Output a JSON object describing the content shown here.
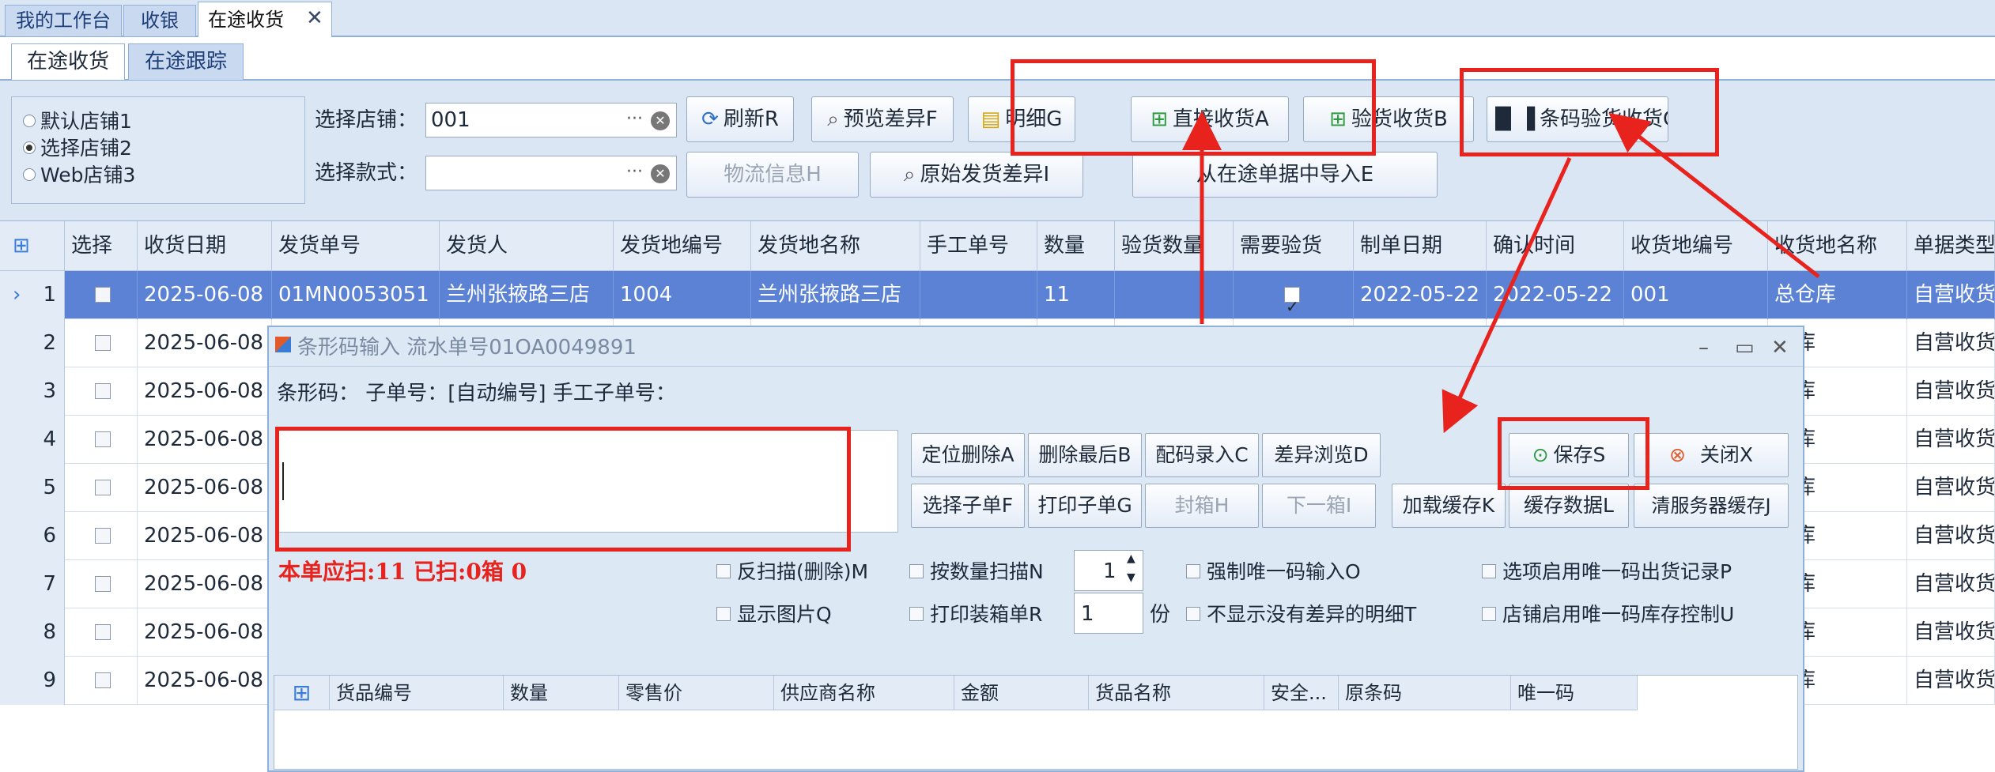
{
  "top_tabs": [
    {
      "label": "我的工作台"
    },
    {
      "label": "收银"
    },
    {
      "label": "在途收货",
      "active": true
    }
  ],
  "sub_tabs": [
    {
      "label": "在途收货",
      "active": true
    },
    {
      "label": "在途跟踪"
    }
  ],
  "filter": {
    "radios": [
      {
        "label": "默认店铺1",
        "selected": false
      },
      {
        "label": "选择店铺2",
        "selected": true
      },
      {
        "label": "Web店铺3",
        "selected": false
      }
    ],
    "store_label": "选择店铺：",
    "store_value": "001",
    "style_label": "选择款式：",
    "style_value": "",
    "buttons": {
      "refresh": "刷新R",
      "preview_diff": "预览差异F",
      "detail": "明细G",
      "direct_receive": "直接收货A",
      "inspect_receive": "验货收货B",
      "barcode_receive": "条码验货收货C",
      "logistics": "物流信息H",
      "orig_diff": "原始发货差异I",
      "import": "从在途单据中导入E"
    }
  },
  "grid": {
    "headers": [
      "选择",
      "收货日期",
      "发货单号",
      "发货人",
      "发货地编号",
      "发货地名称",
      "手工单号",
      "数量",
      "验货数量",
      "需要验货",
      "制单日期",
      "确认时间",
      "收货地编号",
      "收货地名称",
      "单据类型"
    ],
    "rows": [
      {
        "no": "1",
        "date": "2025-06-08",
        "order": "01MN0053051",
        "sender": "兰州张掖路三店",
        "from_code": "1004",
        "from_name": "兰州张掖路三店",
        "manual": "",
        "qty": "11",
        "inspect_qty": "",
        "need_inspect": true,
        "create_date": "2022-05-22",
        "confirm_time": "2022-05-22",
        "to_code": "001",
        "to_name": "总仓库",
        "type": "自营收货"
      },
      {
        "no": "2",
        "date": "2025-06-08",
        "to_name": "仓库",
        "type": "自营收货"
      },
      {
        "no": "3",
        "date": "2025-06-08",
        "to_name": "仓库",
        "type": "自营收货"
      },
      {
        "no": "4",
        "date": "2025-06-08",
        "to_name": "仓库",
        "type": "自营收货"
      },
      {
        "no": "5",
        "date": "2025-06-08",
        "to_name": "仓库",
        "type": "自营收货"
      },
      {
        "no": "6",
        "date": "2025-06-08",
        "to_name": "仓库",
        "type": "自营收货"
      },
      {
        "no": "7",
        "date": "2025-06-08",
        "to_name": "仓库",
        "type": "自营收货"
      },
      {
        "no": "8",
        "date": "2025-06-08",
        "to_name": "仓库",
        "type": "自营收货"
      },
      {
        "no": "9",
        "date": "2025-06-08",
        "to_name": "仓库",
        "type": "自营收货"
      }
    ]
  },
  "dialog": {
    "title": "条形码输入  流水单号01OA0049891",
    "info_label": "条形码：  子单号：[自动编号]  手工子单号：",
    "scan_status": "本单应扫:11  已扫:0箱  0",
    "buttons": {
      "locate_delete": "定位删除A",
      "delete_last": "删除最后B",
      "match_entry": "配码录入C",
      "diff_browse": "差异浏览D",
      "save": "保存S",
      "close": "关闭X",
      "choose_sub": "选择子单F",
      "print_sub": "打印子单G",
      "seal_box": "封箱H",
      "next_box": "下一箱I",
      "load_cache": "加载缓存K",
      "cache_data": "缓存数据L",
      "clear_server_cache": "清服务器缓存J"
    },
    "options": {
      "reverse_scan": "反扫描(删除)M",
      "qty_scan": "按数量扫描N",
      "qty_value": "1",
      "force_unique": "强制唯一码输入O",
      "enable_unique_out": "选项启用唯一码出货记录P",
      "show_image": "显示图片Q",
      "print_box_list": "打印装箱单R",
      "copies_value": "1",
      "copies_unit": "份",
      "hide_no_diff": "不显示没有差异的明细T",
      "store_unique_stock": "店铺启用唯一码库存控制U"
    },
    "subgrid_headers": [
      "货品编号",
      "数量",
      "零售价",
      "供应商名称",
      "金额",
      "货品名称",
      "安全...",
      "原条码",
      "唯一码"
    ]
  },
  "colors": {
    "selected_row": "#5b82d4",
    "highlight_red": "#e8231e",
    "panel_blue": "#dbe6f4"
  }
}
